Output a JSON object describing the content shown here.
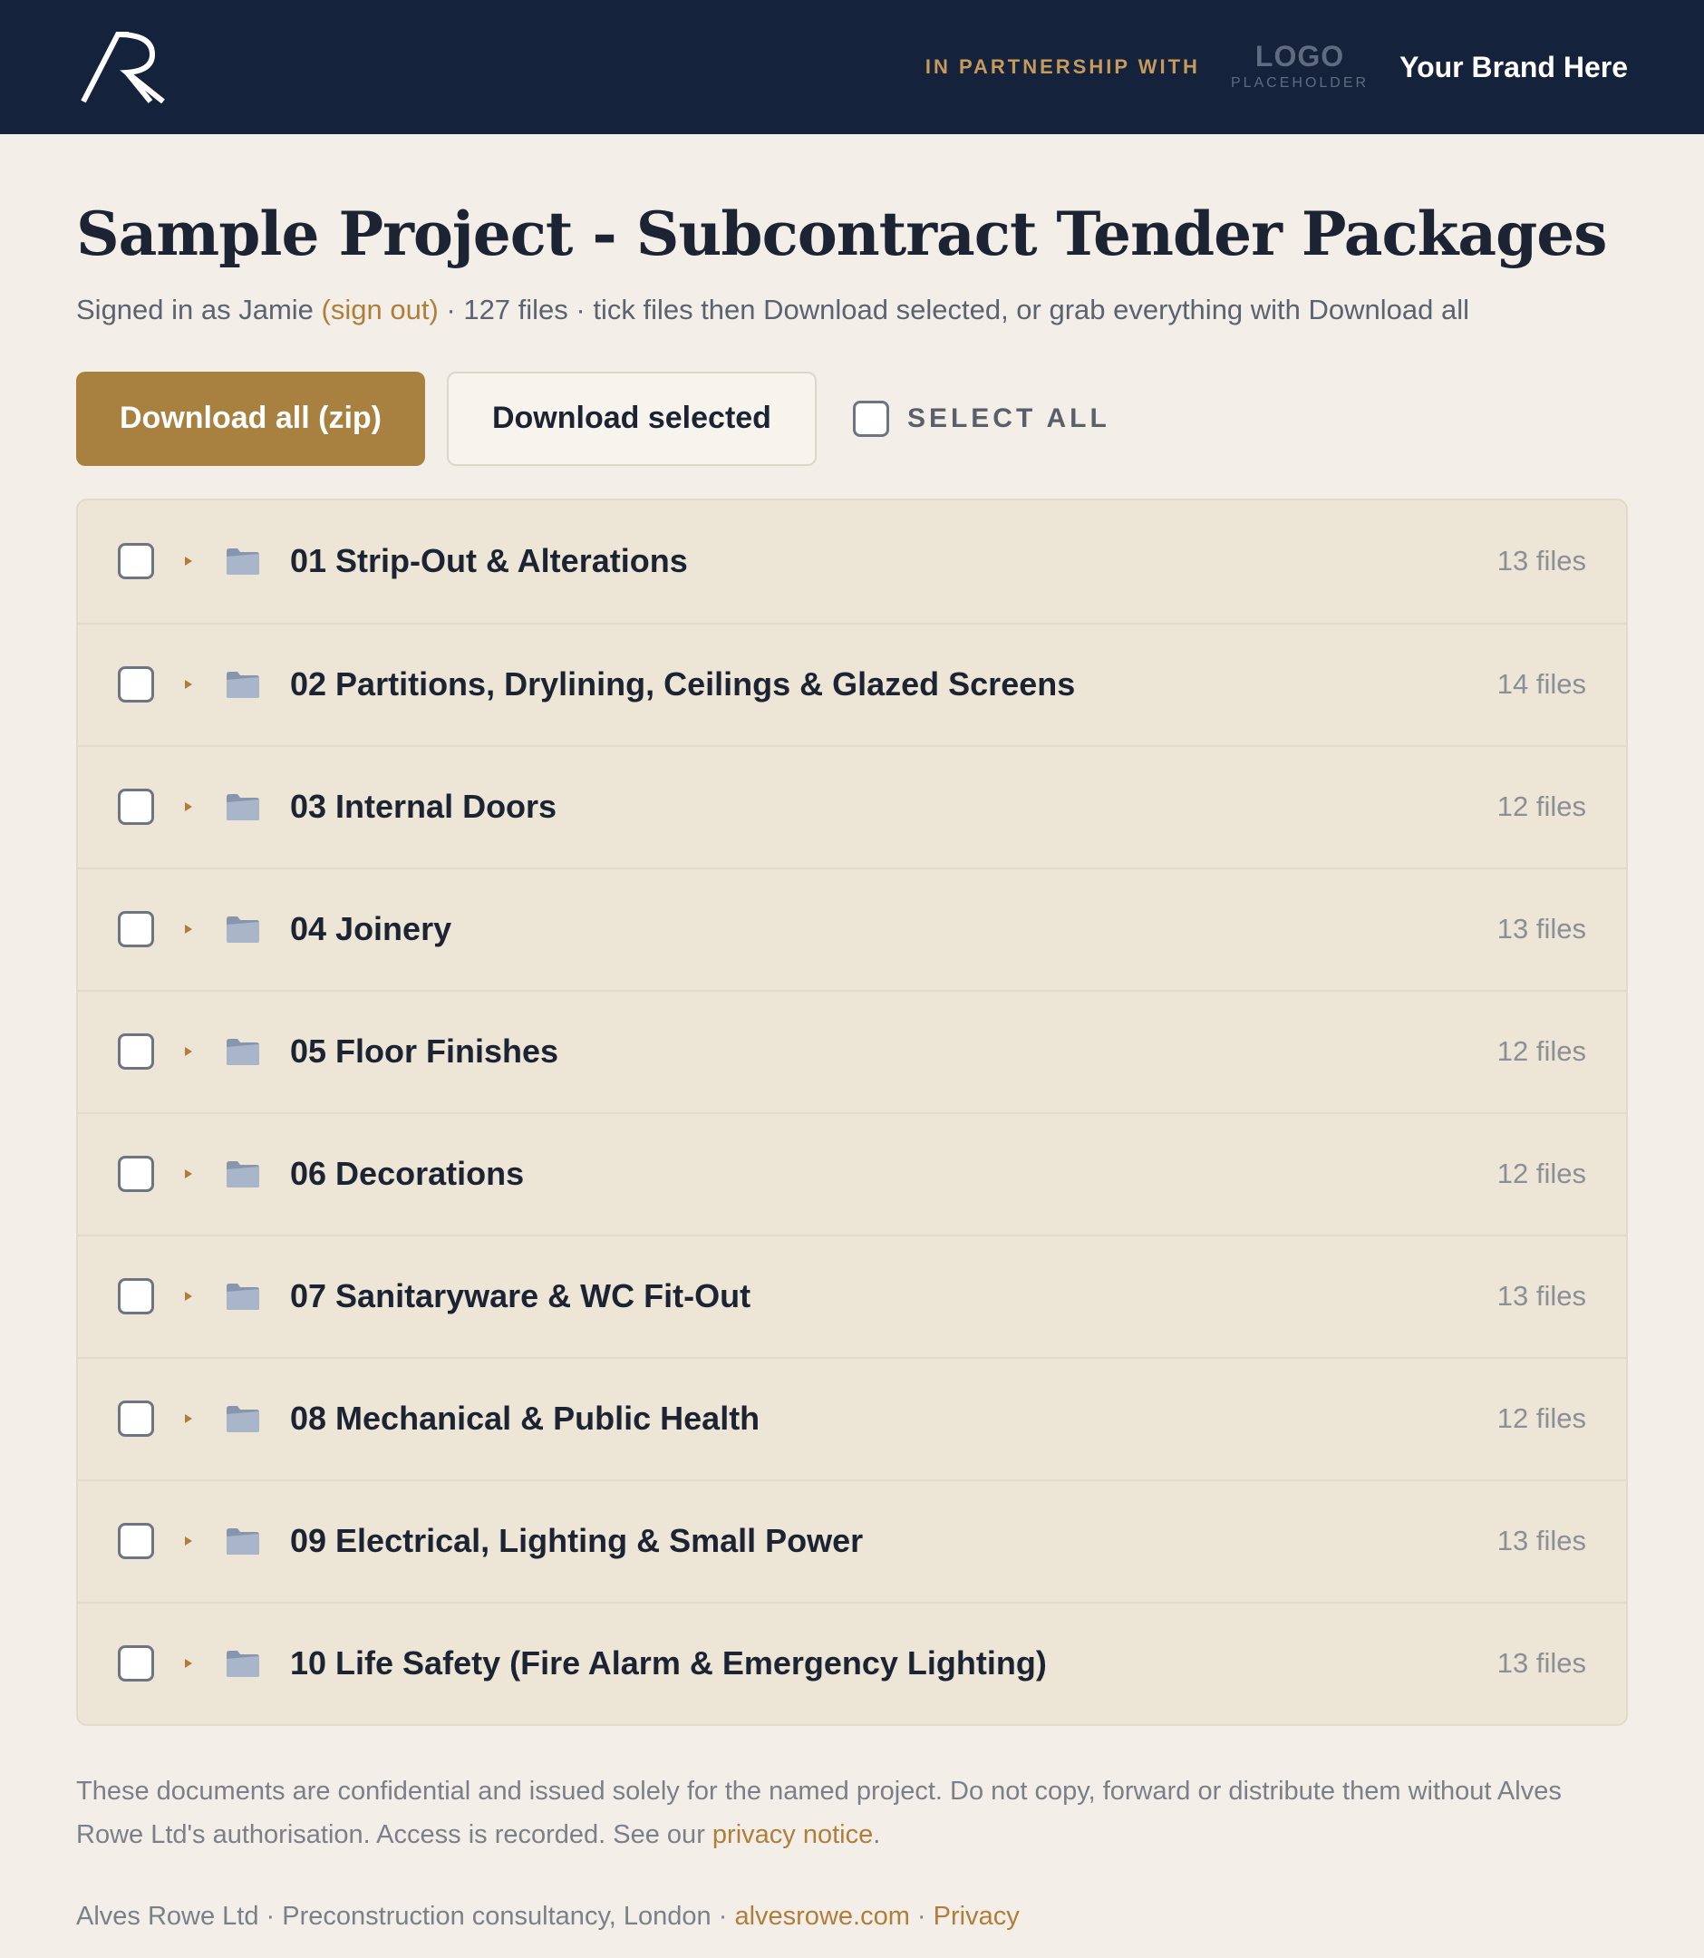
{
  "header": {
    "logo_text": "AR",
    "partner_label": "IN PARTNERSHIP WITH",
    "partner_logo_main": "LOGO",
    "partner_logo_sub": "PLACEHOLDER",
    "partner_brand": "Your Brand Here"
  },
  "page": {
    "title": "Sample Project - Subcontract Tender Packages",
    "signed_in_prefix": "Signed in as Jamie ",
    "sign_out_label": "(sign out)",
    "summary": " · 127 files · tick files then Download selected, or grab everything with Download all"
  },
  "actions": {
    "download_all_label": "Download all (zip)",
    "download_selected_label": "Download selected",
    "select_all_label": "SELECT ALL"
  },
  "folders": [
    {
      "name": "01 Strip-Out & Alterations",
      "count": "13 files"
    },
    {
      "name": "02 Partitions, Drylining, Ceilings & Glazed Screens",
      "count": "14 files"
    },
    {
      "name": "03 Internal Doors",
      "count": "12 files"
    },
    {
      "name": "04 Joinery",
      "count": "13 files"
    },
    {
      "name": "05 Floor Finishes",
      "count": "12 files"
    },
    {
      "name": "06 Decorations",
      "count": "12 files"
    },
    {
      "name": "07 Sanitaryware & WC Fit-Out",
      "count": "13 files"
    },
    {
      "name": "08 Mechanical & Public Health",
      "count": "12 files"
    },
    {
      "name": "09 Electrical, Lighting & Small Power",
      "count": "13 files"
    },
    {
      "name": "10 Life Safety (Fire Alarm & Emergency Lighting)",
      "count": "13 files"
    }
  ],
  "notice": {
    "text": "These documents are confidential and issued solely for the named project. Do not copy, forward or distribute them without Alves Rowe Ltd's authorisation. Access is recorded. See our ",
    "link_label": "privacy notice",
    "end": "."
  },
  "footer": {
    "company": "Alves Rowe Ltd · Preconstruction consultancy, London · ",
    "site_link": "alvesrowe.com",
    "separator": " · ",
    "privacy_link": "Privacy"
  },
  "colors": {
    "header_bg": "#15223b",
    "accent": "#a8803f",
    "link": "#b07e3b",
    "page_bg": "#f3efe8",
    "list_bg": "#ede5d6"
  }
}
